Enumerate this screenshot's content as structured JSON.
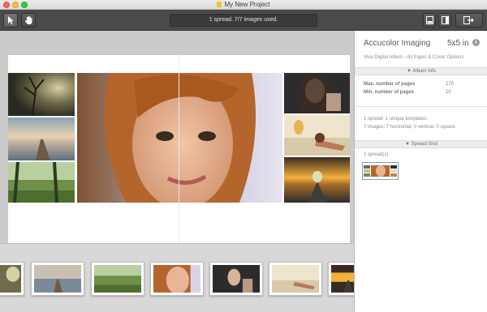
{
  "window": {
    "title": "My New Project"
  },
  "toolbar": {
    "status": "1 spread. 7/7 images used.",
    "tools": [
      "arrow-select-tool",
      "hand-pan-tool"
    ],
    "right_buttons": [
      "single-page-view",
      "sidebar-toggle",
      "export-button"
    ]
  },
  "panel": {
    "vendor": "Accucolor Imaging",
    "size": "5x5 in",
    "info_symbol": "i",
    "subtitle": "Viva Digital Album - All Paper & Cover Options",
    "album_info_header": "▼ Album Info",
    "max_pages_label": "Max. number of pages",
    "max_pages_value": "170",
    "min_pages_label": "Min. number of pages",
    "min_pages_value": "10",
    "templates_text": "1 spread: 1 unique templates.",
    "images_text": "7 images: 7 horizontal, 0 vertical, 0 square.",
    "spread_grid_header": "▼ Spread Grid",
    "spread_count": "1 spread(s)"
  },
  "colors": {
    "toolbar_bg": "#4a4a4a",
    "workspace_bg": "#cbcbcb",
    "grid_selection": "#6f9fd8"
  }
}
